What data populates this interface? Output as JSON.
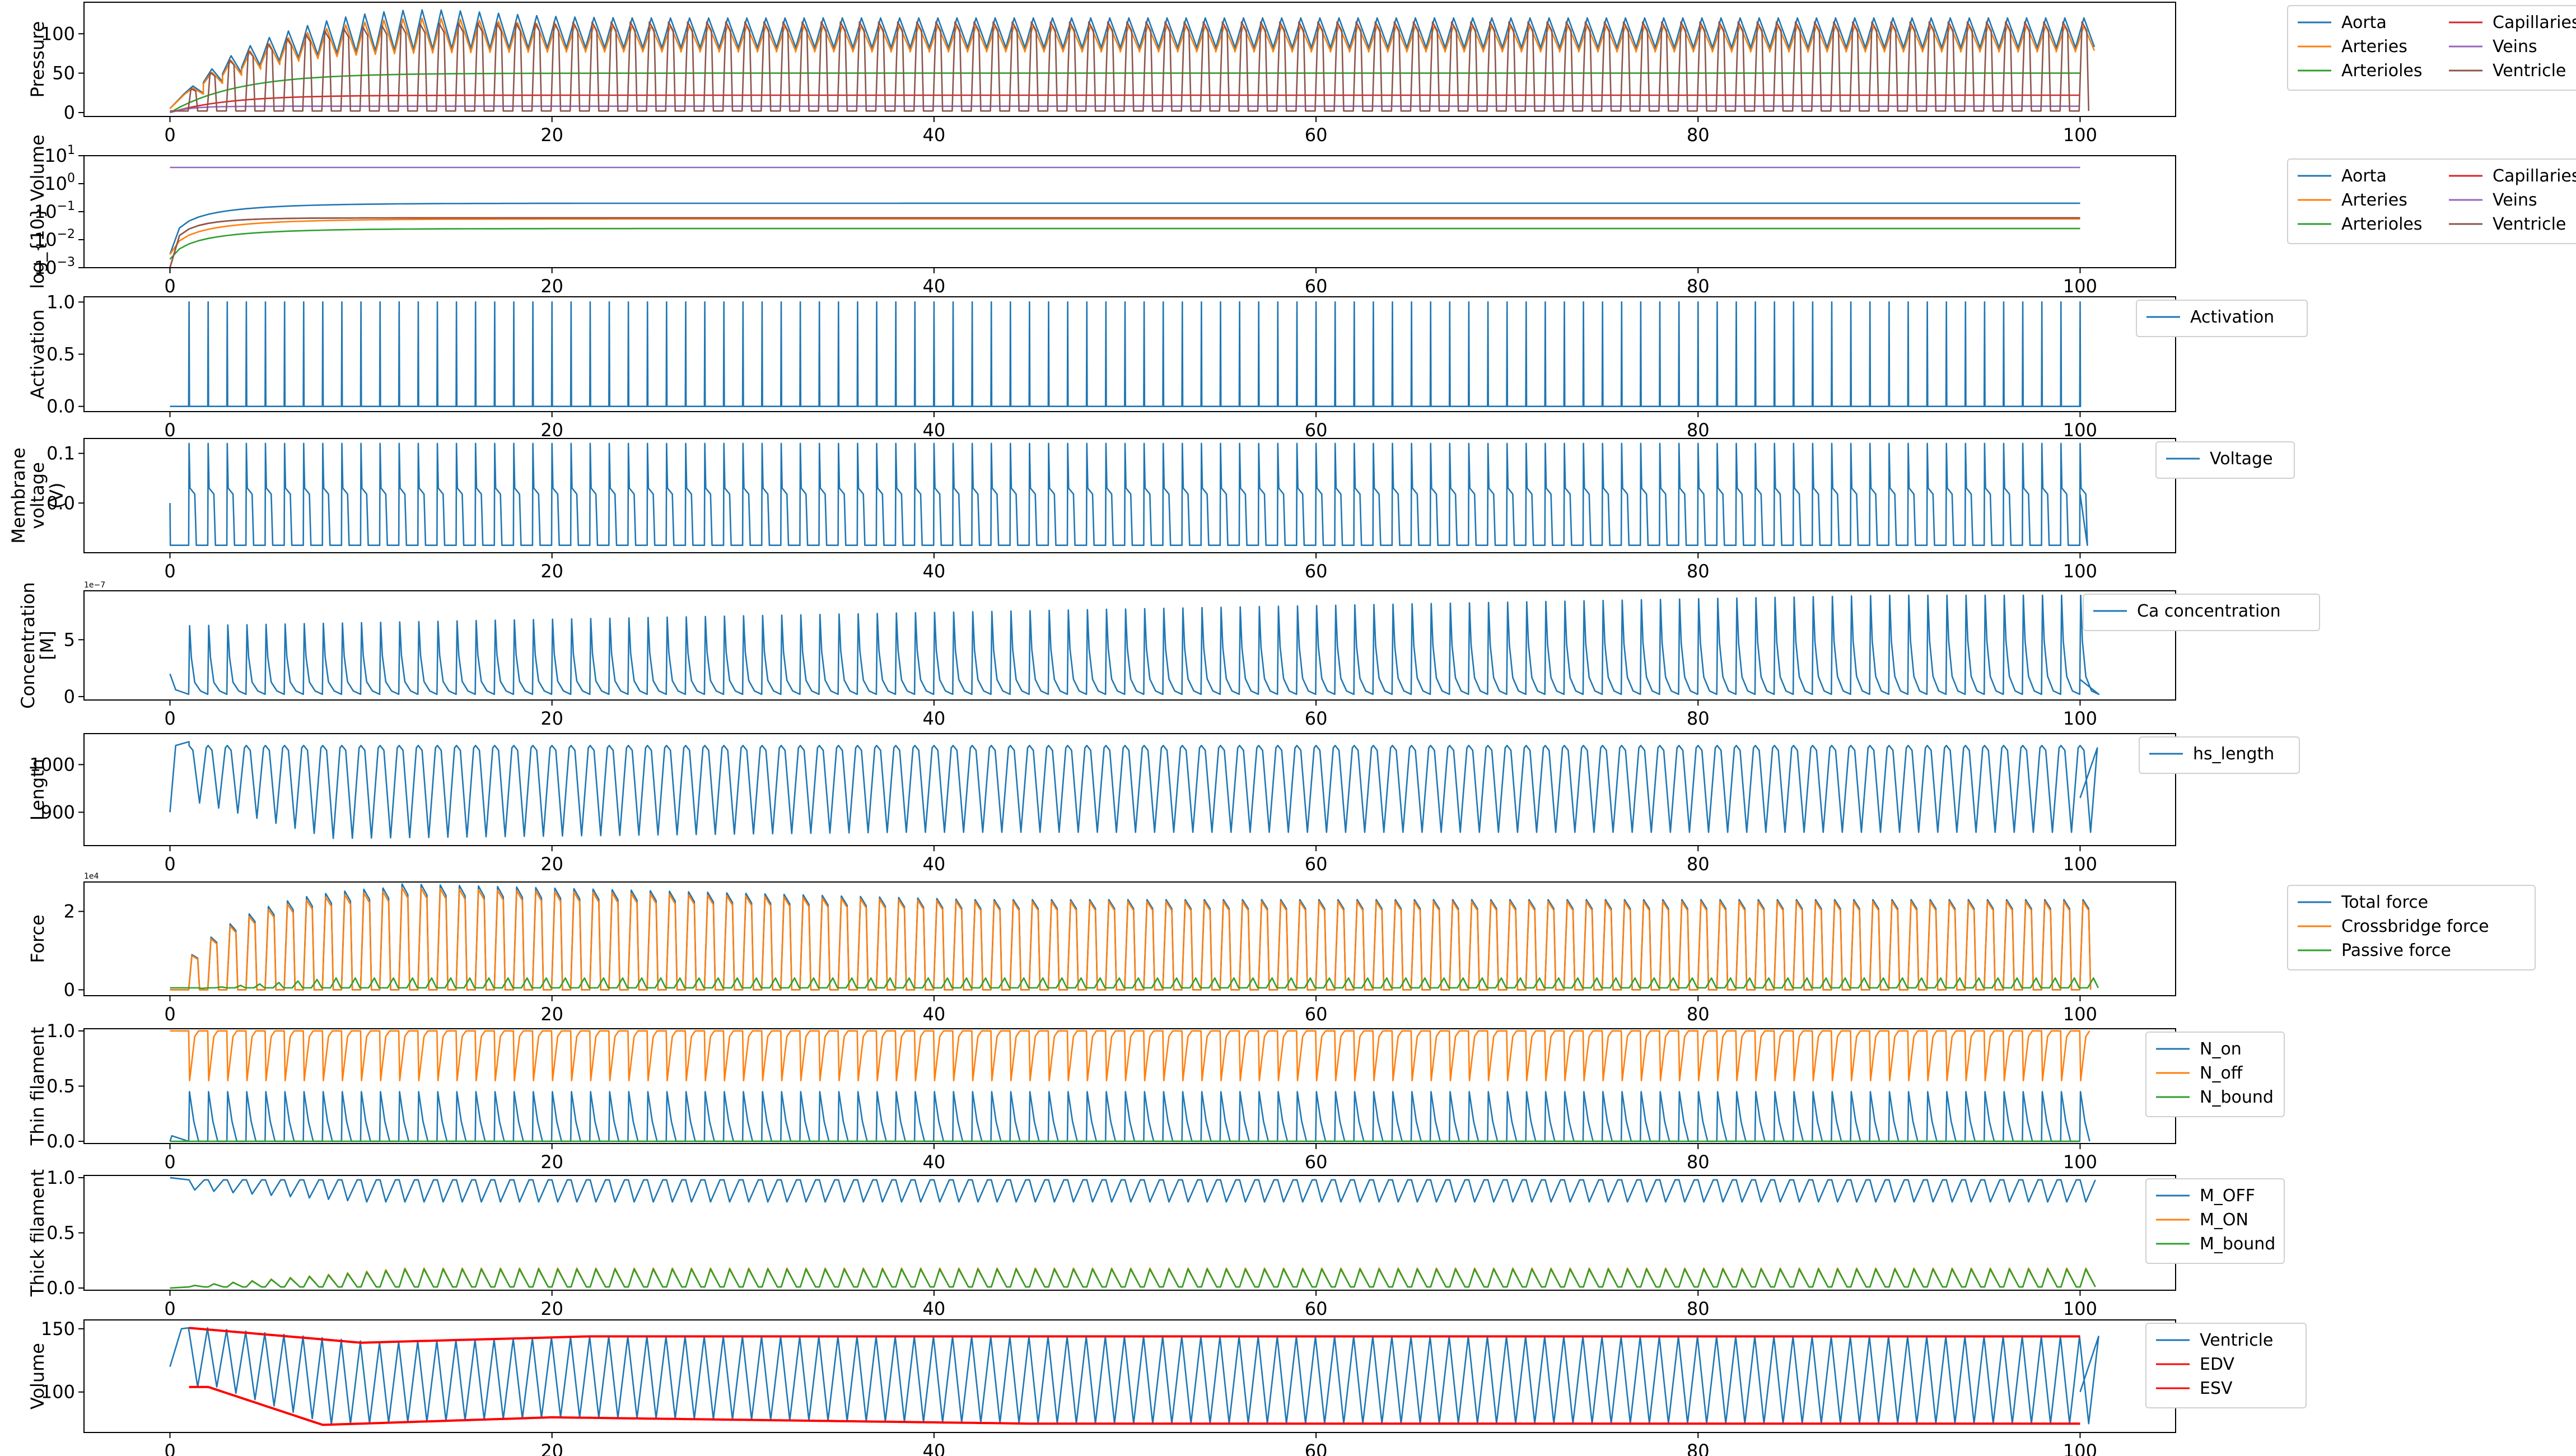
{
  "chart_data": [
    {
      "type": "line",
      "ylabel": "Pressure",
      "xlim": [
        -4.5,
        105
      ],
      "ylim": [
        -5,
        140
      ],
      "yscale": "linear",
      "x_ticks": [
        0,
        20,
        40,
        60,
        80,
        100
      ],
      "y_ticks": [
        {
          "v": 0,
          "label": "0"
        },
        {
          "v": 50,
          "label": "50"
        },
        {
          "v": 100,
          "label": "100"
        }
      ],
      "legend": {
        "position": "right-outside",
        "columns": 2
      },
      "series": [
        {
          "name": "Aorta",
          "color": "#1f77b4",
          "shape": "pulse",
          "base": 90,
          "amp": 30,
          "rise_tau": 3.5,
          "start": 5
        },
        {
          "name": "Arteries",
          "color": "#ff7f0e",
          "shape": "pulse",
          "base": 85,
          "amp": 25,
          "rise_tau": 3.5,
          "start": 5
        },
        {
          "name": "Arterioles",
          "color": "#2ca02c",
          "shape": "plateau",
          "value": 50,
          "rise_tau": 3.5,
          "start": 0
        },
        {
          "name": "Capillaries",
          "color": "#d62728",
          "shape": "plateau",
          "value": 22,
          "rise_tau": 3,
          "start": 0
        },
        {
          "name": "Veins",
          "color": "#9467bd",
          "shape": "plateau",
          "value": 8,
          "rise_tau": 1,
          "start": 0
        },
        {
          "name": "Ventricle",
          "color": "#8c564b",
          "shape": "beat",
          "low": 2,
          "high": 115,
          "start": 0
        }
      ]
    },
    {
      "type": "line",
      "ylabel": "log_{10} Volume",
      "xlim": [
        -4.5,
        105
      ],
      "ylim": [
        0.001,
        10
      ],
      "yscale": "log",
      "x_ticks": [
        0,
        20,
        40,
        60,
        80,
        100
      ],
      "y_ticks": [
        {
          "v": 0.001,
          "base": "10",
          "exp": "−3"
        },
        {
          "v": 0.01,
          "base": "10",
          "exp": "−2"
        },
        {
          "v": 0.1,
          "base": "10",
          "exp": "−1"
        },
        {
          "v": 1,
          "base": "10",
          "exp": "0"
        },
        {
          "v": 10,
          "base": "10",
          "exp": "1"
        }
      ],
      "legend": {
        "position": "right-outside",
        "columns": 2
      },
      "series": [
        {
          "name": "Aorta",
          "color": "#1f77b4",
          "shape": "plateau",
          "value": 0.2,
          "rise_tau": 4,
          "start": 0.003
        },
        {
          "name": "Arteries",
          "color": "#ff7f0e",
          "shape": "plateau",
          "value": 0.055,
          "rise_tau": 4,
          "start": 0.003
        },
        {
          "name": "Arterioles",
          "color": "#2ca02c",
          "shape": "plateau",
          "value": 0.025,
          "rise_tau": 4,
          "start": 0.002
        },
        {
          "name": "Capillaries",
          "color": "#d62728",
          "shape": "plateau",
          "value": 0.06,
          "rise_tau": 2,
          "start": 0.001
        },
        {
          "name": "Veins",
          "color": "#9467bd",
          "shape": "plateau",
          "value": 3.8,
          "rise_tau": 0.5,
          "start": 3.8
        },
        {
          "name": "Ventricle",
          "color": "#8c564b",
          "shape": "plateau",
          "value": 0.06,
          "rise_tau": 2,
          "start": 0.001
        }
      ]
    },
    {
      "type": "line",
      "ylabel": "Activation",
      "xlim": [
        -4.5,
        105
      ],
      "ylim": [
        -0.05,
        1.05
      ],
      "yscale": "linear",
      "x_ticks": [
        0,
        20,
        40,
        60,
        80,
        100
      ],
      "y_ticks": [
        {
          "v": 0,
          "label": "0.0"
        },
        {
          "v": 0.5,
          "label": "0.5"
        },
        {
          "v": 1,
          "label": "1.0"
        }
      ],
      "legend": {
        "position": "right-outside",
        "columns": 1
      },
      "series": [
        {
          "name": "Activation",
          "color": "#1f77b4",
          "shape": "spike",
          "low": 0,
          "high": 1
        }
      ]
    },
    {
      "type": "line",
      "ylabel": "Membrane voltage (V)",
      "xlim": [
        -4.5,
        105
      ],
      "ylim": [
        -0.1,
        0.13
      ],
      "yscale": "linear",
      "x_ticks": [
        0,
        20,
        40,
        60,
        80,
        100
      ],
      "y_ticks": [
        {
          "v": 0,
          "label": "0.0"
        },
        {
          "v": 0.1,
          "label": "0.1"
        }
      ],
      "legend": {
        "position": "right-outside",
        "columns": 1
      },
      "series": [
        {
          "name": "Voltage",
          "color": "#1f77b4",
          "shape": "ap",
          "rest": -0.085,
          "peak": 0.12,
          "plateau": 0.03
        }
      ]
    },
    {
      "type": "line",
      "ylabel": "Concentration [M]",
      "exponent_label": "1e−7",
      "xlim": [
        -4.5,
        105
      ],
      "ylim": [
        -0.3,
        9.3
      ],
      "yscale": "linear",
      "x_ticks": [
        0,
        20,
        40,
        60,
        80,
        100
      ],
      "y_ticks": [
        {
          "v": 0,
          "label": "0"
        },
        {
          "v": 5,
          "label": "5"
        }
      ],
      "legend": {
        "position": "right-outside",
        "columns": 1
      },
      "series": [
        {
          "name": "Ca concentration",
          "color": "#1f77b4",
          "shape": "calcium",
          "low": 0.2,
          "peak_start": 6.2,
          "peak_end": 8.9
        }
      ]
    },
    {
      "type": "line",
      "ylabel": "Length",
      "xlim": [
        -4.5,
        105
      ],
      "ylim": [
        830,
        1065
      ],
      "yscale": "linear",
      "x_ticks": [
        0,
        20,
        40,
        60,
        80,
        100
      ],
      "y_ticks": [
        {
          "v": 900,
          "label": "900"
        },
        {
          "v": 1000,
          "label": "1000"
        }
      ],
      "legend": {
        "position": "right-outside",
        "columns": 1
      },
      "series": [
        {
          "name": "hs_length",
          "color": "#1f77b4",
          "shape": "length",
          "high": 1040,
          "low_start": 930,
          "low_min": 845,
          "low_end": 858
        }
      ]
    },
    {
      "type": "line",
      "ylabel": "Force",
      "exponent_label": "1e4",
      "xlim": [
        -4.5,
        105
      ],
      "ylim": [
        -0.15,
        2.75
      ],
      "yscale": "linear",
      "x_ticks": [
        0,
        20,
        40,
        60,
        80,
        100
      ],
      "y_ticks": [
        {
          "v": 0,
          "label": "0"
        },
        {
          "v": 2,
          "label": "2"
        }
      ],
      "legend": {
        "position": "right-outside",
        "columns": 1
      },
      "series": [
        {
          "name": "Total force",
          "color": "#1f77b4",
          "shape": "force",
          "peak_start": 0.3,
          "peak_max": 2.7,
          "peak_end": 2.3
        },
        {
          "name": "Crossbridge force",
          "color": "#ff7f0e",
          "shape": "force",
          "peak_start": 0.3,
          "peak_max": 2.6,
          "peak_end": 2.25
        },
        {
          "name": "Passive force",
          "color": "#2ca02c",
          "shape": "passive",
          "low": 0.05,
          "high": 0.3
        }
      ]
    },
    {
      "type": "line",
      "ylabel": "Thin filament",
      "xlim": [
        -4.5,
        105
      ],
      "ylim": [
        -0.02,
        1.02
      ],
      "yscale": "linear",
      "x_ticks": [
        0,
        20,
        40,
        60,
        80,
        100
      ],
      "y_ticks": [
        {
          "v": 0,
          "label": "0.0"
        },
        {
          "v": 0.5,
          "label": "0.5"
        },
        {
          "v": 1,
          "label": "1.0"
        }
      ],
      "legend": {
        "position": "right-outside",
        "columns": 1
      },
      "series": [
        {
          "name": "N_on",
          "color": "#1f77b4",
          "shape": "won",
          "low": 0,
          "high": 0.45
        },
        {
          "name": "N_off",
          "color": "#ff7f0e",
          "shape": "woff",
          "high": 1,
          "low": 0.55
        },
        {
          "name": "N_bound",
          "color": "#2ca02c",
          "shape": "flat",
          "value": 0
        }
      ]
    },
    {
      "type": "line",
      "ylabel": "Thick filament",
      "xlim": [
        -4.5,
        105
      ],
      "ylim": [
        -0.02,
        1.02
      ],
      "yscale": "linear",
      "x_ticks": [
        0,
        20,
        40,
        60,
        80,
        100
      ],
      "y_ticks": [
        {
          "v": 0,
          "label": "0.0"
        },
        {
          "v": 0.5,
          "label": "0.5"
        },
        {
          "v": 1,
          "label": "1.0"
        }
      ],
      "legend": {
        "position": "right-outside",
        "columns": 1
      },
      "series": [
        {
          "name": "M_OFF",
          "color": "#1f77b4",
          "shape": "moff",
          "high": 0.98,
          "low": 0.78
        },
        {
          "name": "M_ON",
          "color": "#ff7f0e",
          "shape": "mon",
          "low": 0.01,
          "high": 0.18
        },
        {
          "name": "M_bound",
          "color": "#2ca02c",
          "shape": "mon",
          "low": 0.01,
          "high": 0.17
        }
      ]
    },
    {
      "type": "line",
      "ylabel": "Volume",
      "xlim": [
        -4.5,
        105
      ],
      "ylim": [
        68,
        157
      ],
      "yscale": "linear",
      "x_ticks": [
        0,
        20,
        40,
        60,
        80,
        100
      ],
      "y_ticks": [
        {
          "v": 100,
          "label": "100"
        },
        {
          "v": 150,
          "label": "150"
        }
      ],
      "legend": {
        "position": "right-outside",
        "columns": 1
      },
      "series": [
        {
          "name": "Ventricle",
          "color": "#1f77b4",
          "shape": "vvol"
        },
        {
          "name": "EDV",
          "color": "#ff0000",
          "shape": "edv"
        },
        {
          "name": "ESV",
          "color": "#ff0000",
          "shape": "esv"
        }
      ]
    }
  ]
}
